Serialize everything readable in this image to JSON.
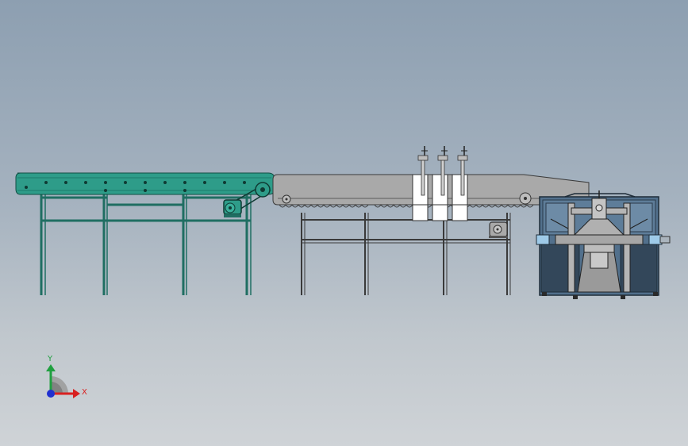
{
  "viewport": {
    "background_top": "#8d9fb1",
    "background_bottom": "#cfd3d7"
  },
  "machines": {
    "infeed_conveyor": {
      "color": "#2e9c89",
      "frame_color": "#1f6e62"
    },
    "middle_conveyor": {
      "color": "#a9a9a9",
      "frame_color": "#3a3a3a"
    },
    "vertical_guides": {
      "count": 3,
      "color": "#ffffff"
    },
    "end_unit": {
      "color": "#4a6a86",
      "frame_color": "#2a3a4a"
    }
  },
  "triad": {
    "x_label": "X",
    "y_label": "Y",
    "x_color": "#d82020",
    "y_color": "#20a040",
    "z_color": "#2030d0"
  }
}
